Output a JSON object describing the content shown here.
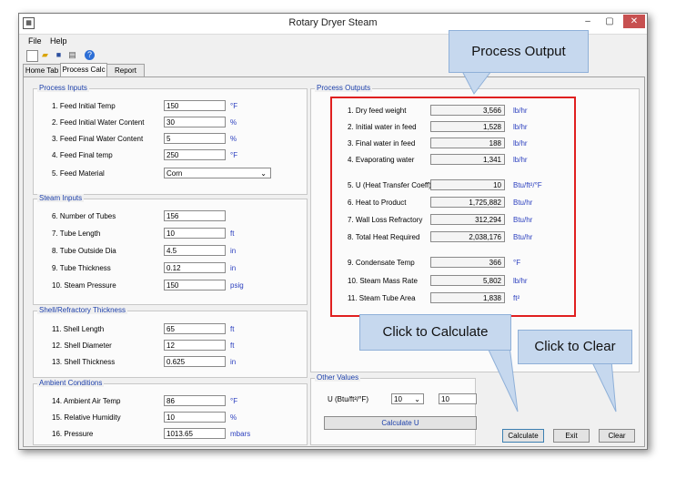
{
  "window": {
    "title": "Rotary Dryer Steam"
  },
  "menu": {
    "file": "File",
    "help": "Help"
  },
  "tabs": {
    "home": "Home Tab",
    "process_calc": "Process Calc",
    "report": "Report"
  },
  "process_inputs": {
    "title": "Process Inputs",
    "rows": [
      {
        "label": "1. Feed Initial Temp",
        "value": "150",
        "unit": "°F"
      },
      {
        "label": "2. Feed Initial Water Content",
        "value": "30",
        "unit": "%"
      },
      {
        "label": "3. Feed Final Water Content",
        "value": "5",
        "unit": "%"
      },
      {
        "label": "4. Feed Final temp",
        "value": "250",
        "unit": "°F"
      },
      {
        "label": "5. Feed Material",
        "value": "Corn",
        "unit": ""
      }
    ]
  },
  "steam_inputs": {
    "title": "Steam Inputs",
    "rows": [
      {
        "label": "6. Number of Tubes",
        "value": "156",
        "unit": ""
      },
      {
        "label": "7. Tube Length",
        "value": "10",
        "unit": "ft"
      },
      {
        "label": "8. Tube Outside Dia",
        "value": "4.5",
        "unit": "in"
      },
      {
        "label": "9. Tube Thickness",
        "value": "0.12",
        "unit": "in"
      },
      {
        "label": "10. Steam Pressure",
        "value": "150",
        "unit": "psig"
      }
    ]
  },
  "shell_inputs": {
    "title": "Shell/Refractory Thickness",
    "rows": [
      {
        "label": "11. Shell Length",
        "value": "65",
        "unit": "ft"
      },
      {
        "label": "12. Shell Diameter",
        "value": "12",
        "unit": "ft"
      },
      {
        "label": "13. Shell Thickness",
        "value": "0.625",
        "unit": "in"
      }
    ]
  },
  "ambient": {
    "title": "Ambient Conditions",
    "rows": [
      {
        "label": "14. Ambient Air Temp",
        "value": "86",
        "unit": "°F"
      },
      {
        "label": "15. Relative Humidity",
        "value": "10",
        "unit": "%"
      },
      {
        "label": "16. Pressure",
        "value": "1013.65",
        "unit": "mbars"
      }
    ]
  },
  "process_outputs": {
    "title": "Process Outputs",
    "rows": [
      {
        "label": "1. Dry feed weight",
        "value": "3,566",
        "unit": "lb/hr"
      },
      {
        "label": "2. Initial water in feed",
        "value": "1,528",
        "unit": "lb/hr"
      },
      {
        "label": "3. Final water in feed",
        "value": "188",
        "unit": "lb/hr"
      },
      {
        "label": "4. Evaporating water",
        "value": "1,341",
        "unit": "lb/hr"
      },
      {
        "label": "5. U (Heat Transfer Coeff)",
        "value": "10",
        "unit": "Btu/ft²/°F"
      },
      {
        "label": "6. Heat to Product",
        "value": "1,725,882",
        "unit": "Btu/hr"
      },
      {
        "label": "7. Wall Loss Refractory",
        "value": "312,294",
        "unit": "Btu/hr"
      },
      {
        "label": "8. Total Heat Required",
        "value": "2,038,176",
        "unit": "Btu/hr"
      },
      {
        "label": "9. Condensate Temp",
        "value": "366",
        "unit": "°F"
      },
      {
        "label": "10. Steam Mass Rate",
        "value": "5,802",
        "unit": "lb/hr"
      },
      {
        "label": "11. Steam Tube Area",
        "value": "1,838",
        "unit": "ft²"
      }
    ]
  },
  "other_values": {
    "title": "Other Values",
    "u_label": "U (Btu/ft²/°F)",
    "u_select": "10",
    "u_value": "10",
    "calc_u_button": "Calculate U"
  },
  "buttons": {
    "calculate": "Calculate",
    "exit": "Exit",
    "clear": "Clear"
  },
  "callouts": {
    "process_output": "Process Output",
    "click_calculate": "Click to Calculate",
    "click_clear": "Click to Clear"
  }
}
